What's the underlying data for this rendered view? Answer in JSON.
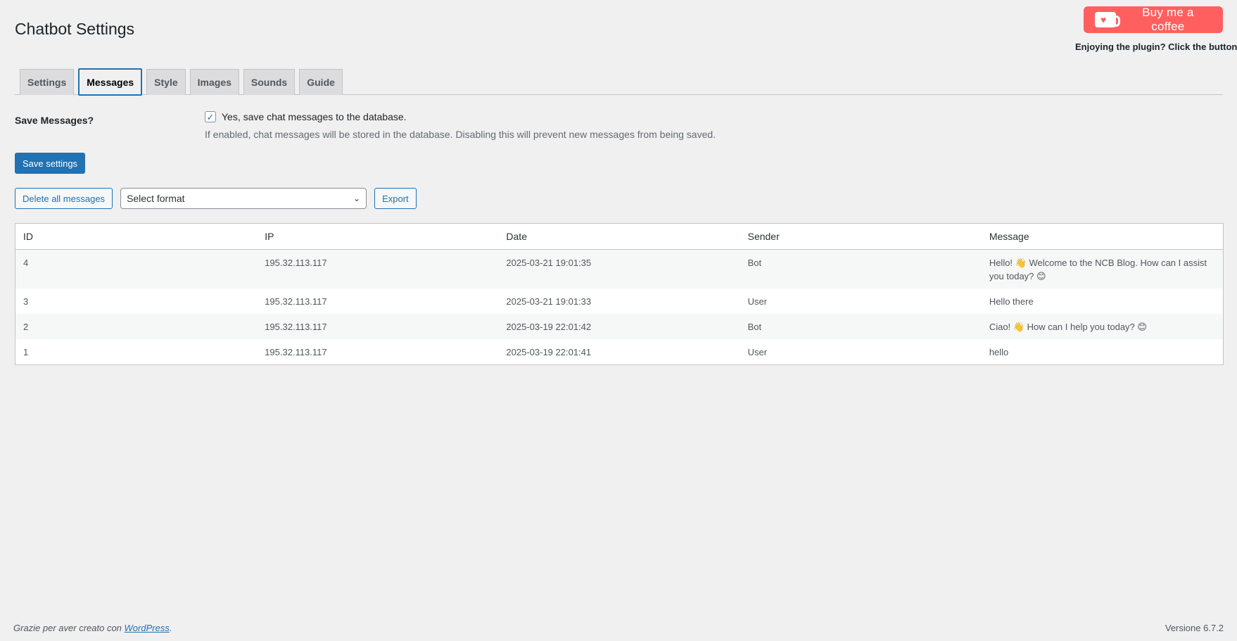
{
  "page": {
    "title": "Chatbot Settings"
  },
  "coffee": {
    "label": "Buy me a coffee",
    "caption": "Enjoying the plugin? Click the button!",
    "heart": "♥"
  },
  "tabs": [
    {
      "label": "Settings"
    },
    {
      "label": "Messages",
      "active": true
    },
    {
      "label": "Style"
    },
    {
      "label": "Images"
    },
    {
      "label": "Sounds"
    },
    {
      "label": "Guide"
    }
  ],
  "save_messages": {
    "label": "Save Messages?",
    "checkbox_label": "Yes, save chat messages to the database.",
    "checked": true,
    "check_mark": "✓",
    "description": "If enabled, chat messages will be stored in the database. Disabling this will prevent new messages from being saved."
  },
  "buttons": {
    "save": "Save settings",
    "delete_all": "Delete all messages",
    "export": "Export"
  },
  "format_select": {
    "value": "Select format",
    "chevron": "⌄"
  },
  "table": {
    "headers": [
      "ID",
      "IP",
      "Date",
      "Sender",
      "Message"
    ],
    "rows": [
      [
        "4",
        "195.32.113.117",
        "2025-03-21 19:01:35",
        "Bot",
        "Hello! 👋 Welcome to the NCB Blog. How can I assist you today? 😊"
      ],
      [
        "3",
        "195.32.113.117",
        "2025-03-21 19:01:33",
        "User",
        "Hello there"
      ],
      [
        "2",
        "195.32.113.117",
        "2025-03-19 22:01:42",
        "Bot",
        "Ciao! 👋 How can I help you today? 😊"
      ],
      [
        "1",
        "195.32.113.117",
        "2025-03-19 22:01:41",
        "User",
        "hello"
      ]
    ]
  },
  "footer": {
    "thanks_prefix": "Grazie per aver creato con ",
    "wordpress_link": "WordPress",
    "thanks_suffix": ".",
    "version": "Versione 6.7.2"
  },
  "colors": {
    "primary": "#2271b1",
    "coffee": "#ff5f5f",
    "background": "#f0f0f1"
  }
}
